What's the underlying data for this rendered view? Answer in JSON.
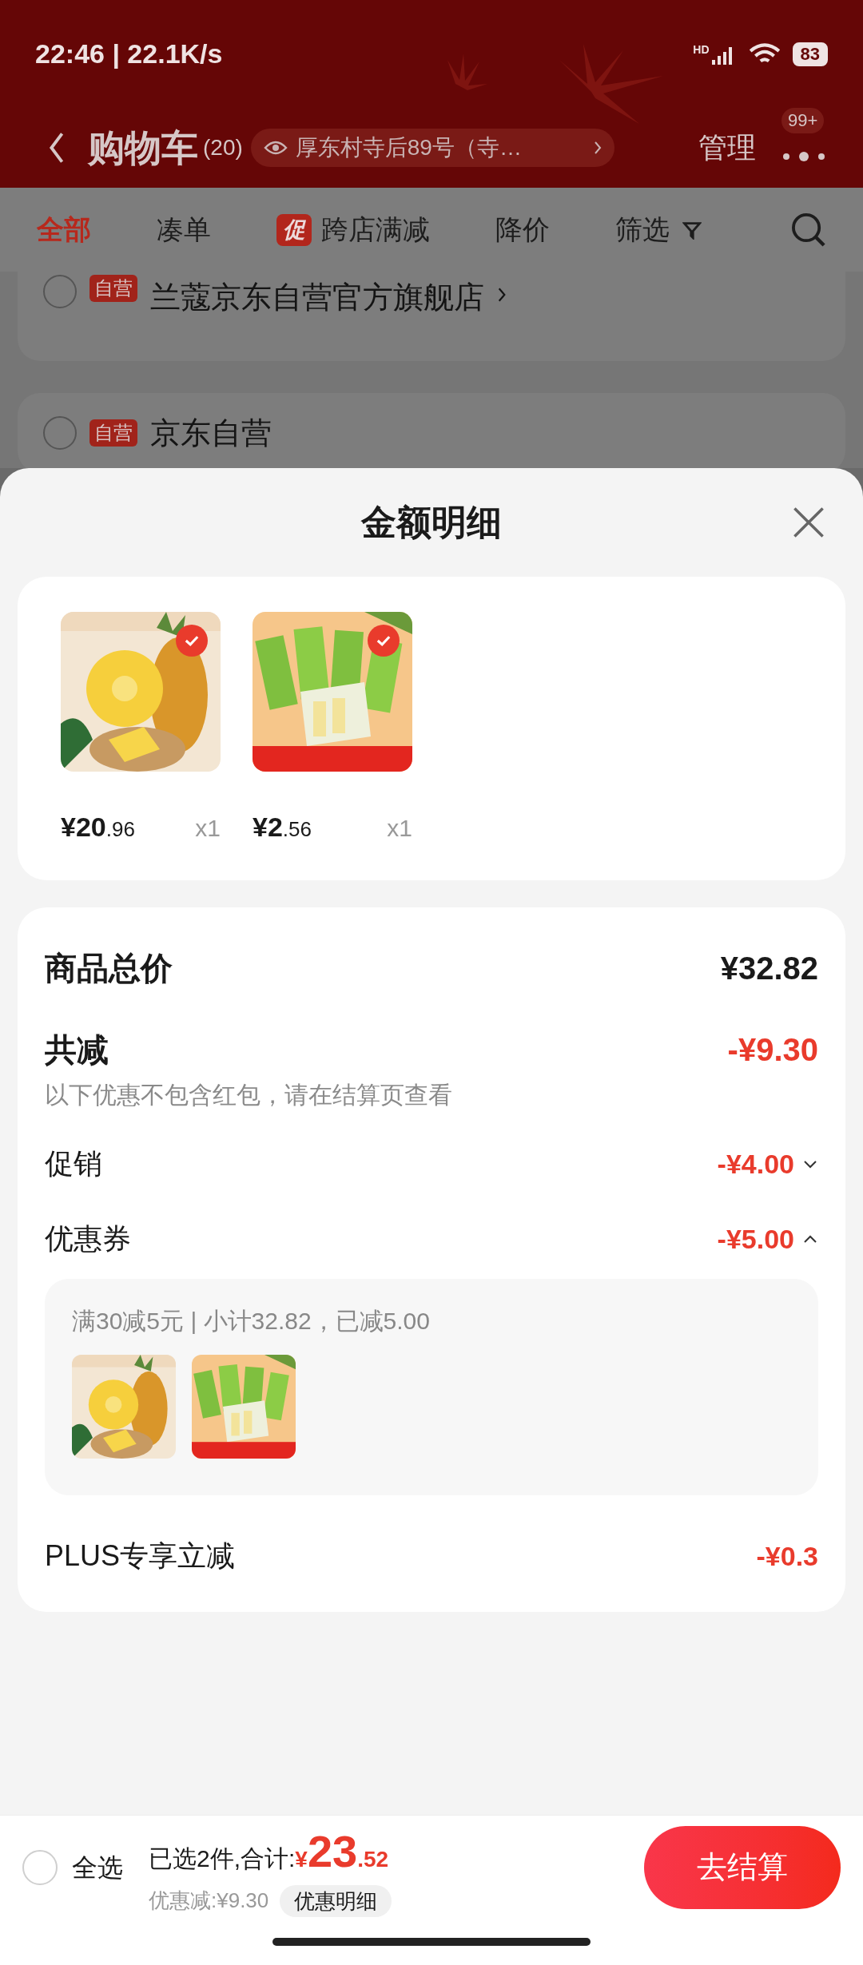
{
  "status_bar": {
    "time": "22:46 | 22.1K/s",
    "network": "HD",
    "battery": "83"
  },
  "header": {
    "title": "购物车",
    "count": "(20)",
    "address": "厚东村寺后89号（寺…",
    "manage": "管理",
    "more_badge": "99+"
  },
  "tabs": [
    {
      "label": "全部",
      "selected": true
    },
    {
      "label": "凑单",
      "selected": false
    },
    {
      "label": "跨店满减",
      "badge": "促",
      "selected": false
    },
    {
      "label": "降价",
      "selected": false
    },
    {
      "label": "筛选",
      "selected": false
    }
  ],
  "stores": [
    {
      "badge": "自营",
      "name": "兰蔻京东自营官方旗舰店",
      "selected": false
    },
    {
      "badge": "自营",
      "name": "京东自营",
      "selected": false
    }
  ],
  "sheet": {
    "title": "金额明细",
    "products": [
      {
        "price": "¥20",
        "price_decimals": ".96",
        "quantity": "x1",
        "selected": true
      },
      {
        "price": "¥2",
        "price_decimals": ".56",
        "quantity": "x1",
        "selected": true
      }
    ],
    "total": {
      "label": "商品总价",
      "amount": "¥32.82"
    },
    "reduction": {
      "label": "共减",
      "amount": "-¥9.30",
      "note": "以下优惠不包含红包，请在结算页查看"
    },
    "discounts": [
      {
        "label": "促销",
        "amount": "-¥4.00",
        "expanded": false
      },
      {
        "label": "优惠券",
        "amount": "-¥5.00",
        "expanded": true,
        "detail": {
          "text": "满30减5元 | 小计32.82，已减5.00"
        }
      }
    ],
    "plus_row": {
      "label": "PLUS专享立减",
      "amount": "-¥0.3"
    }
  },
  "bottom_bar": {
    "select_all": {
      "label": "全选",
      "selected": false
    },
    "summary": "已选2件,合计:",
    "currency": "¥",
    "total_int": "23",
    "total_decimals": ".52",
    "saved": "优惠减:¥9.30",
    "details_button": "优惠明细",
    "checkout": "去结算"
  }
}
